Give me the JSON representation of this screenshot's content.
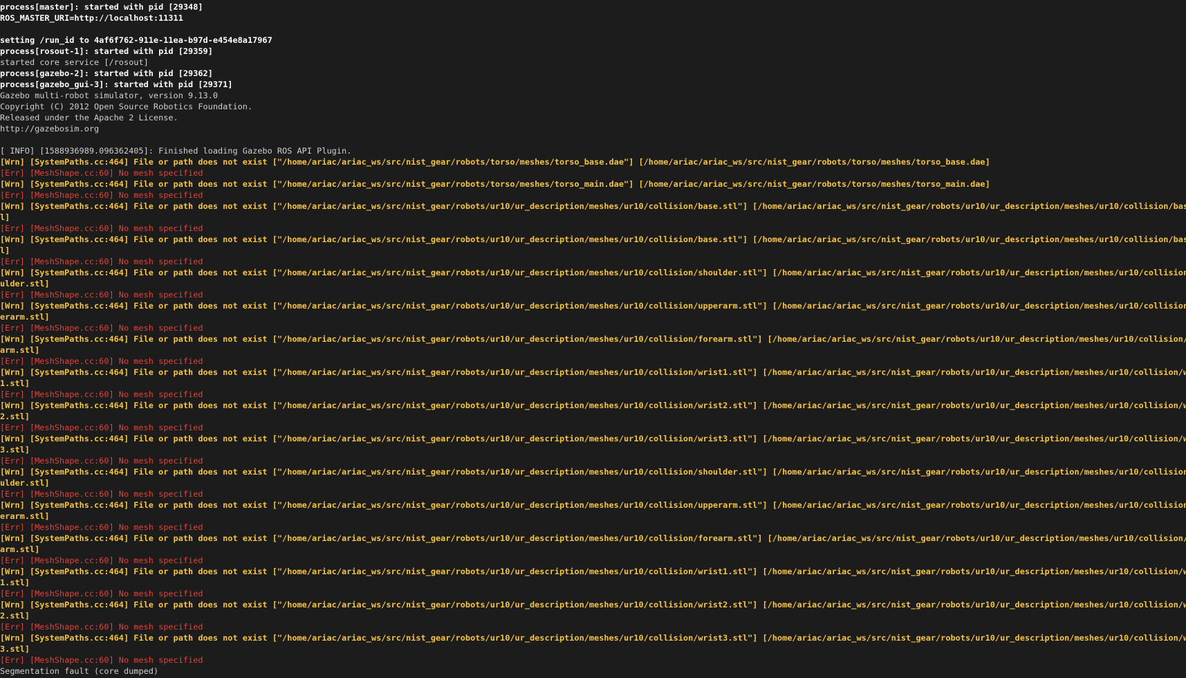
{
  "terminal": {
    "colors": {
      "background": "#1c1c1c",
      "plain": "#cfcfcf",
      "bold": "#ffffff",
      "warn": "#f5c344",
      "error": "#e3413a"
    },
    "lines": [
      {
        "type": "bold",
        "text": "process[master]: started with pid [29348]"
      },
      {
        "type": "bold",
        "text": "ROS_MASTER_URI=http://localhost:11311"
      },
      {
        "type": "blank",
        "text": ""
      },
      {
        "type": "bold",
        "text": "setting /run_id to 4af6f762-911e-11ea-b97d-e454e8a17967"
      },
      {
        "type": "bold",
        "text": "process[rosout-1]: started with pid [29359]"
      },
      {
        "type": "plain",
        "text": "started core service [/rosout]"
      },
      {
        "type": "bold",
        "text": "process[gazebo-2]: started with pid [29362]"
      },
      {
        "type": "bold",
        "text": "process[gazebo_gui-3]: started with pid [29371]"
      },
      {
        "type": "plain",
        "text": "Gazebo multi-robot simulator, version 9.13.0"
      },
      {
        "type": "plain",
        "text": "Copyright (C) 2012 Open Source Robotics Foundation."
      },
      {
        "type": "plain",
        "text": "Released under the Apache 2 License."
      },
      {
        "type": "plain",
        "text": "http://gazebosim.org"
      },
      {
        "type": "blank",
        "text": ""
      },
      {
        "type": "info",
        "text": "[ INFO] [1588936989.096362405]: Finished loading Gazebo ROS API Plugin."
      },
      {
        "type": "wrn",
        "text": "[Wrn] [SystemPaths.cc:464] File or path does not exist [\"/home/ariac/ariac_ws/src/nist_gear/robots/torso/meshes/torso_base.dae\"] [/home/ariac/ariac_ws/src/nist_gear/robots/torso/meshes/torso_base.dae]"
      },
      {
        "type": "err",
        "text": "[Err] [MeshShape.cc:60] No mesh specified"
      },
      {
        "type": "wrn",
        "text": "[Wrn] [SystemPaths.cc:464] File or path does not exist [\"/home/ariac/ariac_ws/src/nist_gear/robots/torso/meshes/torso_main.dae\"] [/home/ariac/ariac_ws/src/nist_gear/robots/torso/meshes/torso_main.dae]"
      },
      {
        "type": "err",
        "text": "[Err] [MeshShape.cc:60] No mesh specified"
      },
      {
        "type": "wrn",
        "text": "[Wrn] [SystemPaths.cc:464] File or path does not exist [\"/home/ariac/ariac_ws/src/nist_gear/robots/ur10/ur_description/meshes/ur10/collision/base.stl\"] [/home/ariac/ariac_ws/src/nist_gear/robots/ur10/ur_description/meshes/ur10/collision/base.st"
      },
      {
        "type": "wrn",
        "text": "l]"
      },
      {
        "type": "err",
        "text": "[Err] [MeshShape.cc:60] No mesh specified"
      },
      {
        "type": "wrn",
        "text": "[Wrn] [SystemPaths.cc:464] File or path does not exist [\"/home/ariac/ariac_ws/src/nist_gear/robots/ur10/ur_description/meshes/ur10/collision/base.stl\"] [/home/ariac/ariac_ws/src/nist_gear/robots/ur10/ur_description/meshes/ur10/collision/base.st"
      },
      {
        "type": "wrn",
        "text": "l]"
      },
      {
        "type": "err",
        "text": "[Err] [MeshShape.cc:60] No mesh specified"
      },
      {
        "type": "wrn",
        "text": "[Wrn] [SystemPaths.cc:464] File or path does not exist [\"/home/ariac/ariac_ws/src/nist_gear/robots/ur10/ur_description/meshes/ur10/collision/shoulder.stl\"] [/home/ariac/ariac_ws/src/nist_gear/robots/ur10/ur_description/meshes/ur10/collision/sho"
      },
      {
        "type": "wrn",
        "text": "ulder.stl]"
      },
      {
        "type": "err",
        "text": "[Err] [MeshShape.cc:60] No mesh specified"
      },
      {
        "type": "wrn",
        "text": "[Wrn] [SystemPaths.cc:464] File or path does not exist [\"/home/ariac/ariac_ws/src/nist_gear/robots/ur10/ur_description/meshes/ur10/collision/upperarm.stl\"] [/home/ariac/ariac_ws/src/nist_gear/robots/ur10/ur_description/meshes/ur10/collision/upp"
      },
      {
        "type": "wrn",
        "text": "erarm.stl]"
      },
      {
        "type": "err",
        "text": "[Err] [MeshShape.cc:60] No mesh specified"
      },
      {
        "type": "wrn",
        "text": "[Wrn] [SystemPaths.cc:464] File or path does not exist [\"/home/ariac/ariac_ws/src/nist_gear/robots/ur10/ur_description/meshes/ur10/collision/forearm.stl\"] [/home/ariac/ariac_ws/src/nist_gear/robots/ur10/ur_description/meshes/ur10/collision/fore"
      },
      {
        "type": "wrn",
        "text": "arm.stl]"
      },
      {
        "type": "err",
        "text": "[Err] [MeshShape.cc:60] No mesh specified"
      },
      {
        "type": "wrn",
        "text": "[Wrn] [SystemPaths.cc:464] File or path does not exist [\"/home/ariac/ariac_ws/src/nist_gear/robots/ur10/ur_description/meshes/ur10/collision/wrist1.stl\"] [/home/ariac/ariac_ws/src/nist_gear/robots/ur10/ur_description/meshes/ur10/collision/wrist"
      },
      {
        "type": "wrn",
        "text": "1.stl]"
      },
      {
        "type": "err",
        "text": "[Err] [MeshShape.cc:60] No mesh specified"
      },
      {
        "type": "wrn",
        "text": "[Wrn] [SystemPaths.cc:464] File or path does not exist [\"/home/ariac/ariac_ws/src/nist_gear/robots/ur10/ur_description/meshes/ur10/collision/wrist2.stl\"] [/home/ariac/ariac_ws/src/nist_gear/robots/ur10/ur_description/meshes/ur10/collision/wrist"
      },
      {
        "type": "wrn",
        "text": "2.stl]"
      },
      {
        "type": "err",
        "text": "[Err] [MeshShape.cc:60] No mesh specified"
      },
      {
        "type": "wrn",
        "text": "[Wrn] [SystemPaths.cc:464] File or path does not exist [\"/home/ariac/ariac_ws/src/nist_gear/robots/ur10/ur_description/meshes/ur10/collision/wrist3.stl\"] [/home/ariac/ariac_ws/src/nist_gear/robots/ur10/ur_description/meshes/ur10/collision/wrist"
      },
      {
        "type": "wrn",
        "text": "3.stl]"
      },
      {
        "type": "err",
        "text": "[Err] [MeshShape.cc:60] No mesh specified"
      },
      {
        "type": "wrn",
        "text": "[Wrn] [SystemPaths.cc:464] File or path does not exist [\"/home/ariac/ariac_ws/src/nist_gear/robots/ur10/ur_description/meshes/ur10/collision/shoulder.stl\"] [/home/ariac/ariac_ws/src/nist_gear/robots/ur10/ur_description/meshes/ur10/collision/sho"
      },
      {
        "type": "wrn",
        "text": "ulder.stl]"
      },
      {
        "type": "err",
        "text": "[Err] [MeshShape.cc:60] No mesh specified"
      },
      {
        "type": "wrn",
        "text": "[Wrn] [SystemPaths.cc:464] File or path does not exist [\"/home/ariac/ariac_ws/src/nist_gear/robots/ur10/ur_description/meshes/ur10/collision/upperarm.stl\"] [/home/ariac/ariac_ws/src/nist_gear/robots/ur10/ur_description/meshes/ur10/collision/upp"
      },
      {
        "type": "wrn",
        "text": "erarm.stl]"
      },
      {
        "type": "err",
        "text": "[Err] [MeshShape.cc:60] No mesh specified"
      },
      {
        "type": "wrn",
        "text": "[Wrn] [SystemPaths.cc:464] File or path does not exist [\"/home/ariac/ariac_ws/src/nist_gear/robots/ur10/ur_description/meshes/ur10/collision/forearm.stl\"] [/home/ariac/ariac_ws/src/nist_gear/robots/ur10/ur_description/meshes/ur10/collision/fore"
      },
      {
        "type": "wrn",
        "text": "arm.stl]"
      },
      {
        "type": "err",
        "text": "[Err] [MeshShape.cc:60] No mesh specified"
      },
      {
        "type": "wrn",
        "text": "[Wrn] [SystemPaths.cc:464] File or path does not exist [\"/home/ariac/ariac_ws/src/nist_gear/robots/ur10/ur_description/meshes/ur10/collision/wrist1.stl\"] [/home/ariac/ariac_ws/src/nist_gear/robots/ur10/ur_description/meshes/ur10/collision/wrist"
      },
      {
        "type": "wrn",
        "text": "1.stl]"
      },
      {
        "type": "err",
        "text": "[Err] [MeshShape.cc:60] No mesh specified"
      },
      {
        "type": "wrn",
        "text": "[Wrn] [SystemPaths.cc:464] File or path does not exist [\"/home/ariac/ariac_ws/src/nist_gear/robots/ur10/ur_description/meshes/ur10/collision/wrist2.stl\"] [/home/ariac/ariac_ws/src/nist_gear/robots/ur10/ur_description/meshes/ur10/collision/wrist"
      },
      {
        "type": "wrn",
        "text": "2.stl]"
      },
      {
        "type": "err",
        "text": "[Err] [MeshShape.cc:60] No mesh specified"
      },
      {
        "type": "wrn",
        "text": "[Wrn] [SystemPaths.cc:464] File or path does not exist [\"/home/ariac/ariac_ws/src/nist_gear/robots/ur10/ur_description/meshes/ur10/collision/wrist3.stl\"] [/home/ariac/ariac_ws/src/nist_gear/robots/ur10/ur_description/meshes/ur10/collision/wrist"
      },
      {
        "type": "wrn",
        "text": "3.stl]"
      },
      {
        "type": "err",
        "text": "[Err] [MeshShape.cc:60] No mesh specified"
      },
      {
        "type": "plain",
        "text": "Segmentation fault (core dumped)"
      }
    ]
  }
}
